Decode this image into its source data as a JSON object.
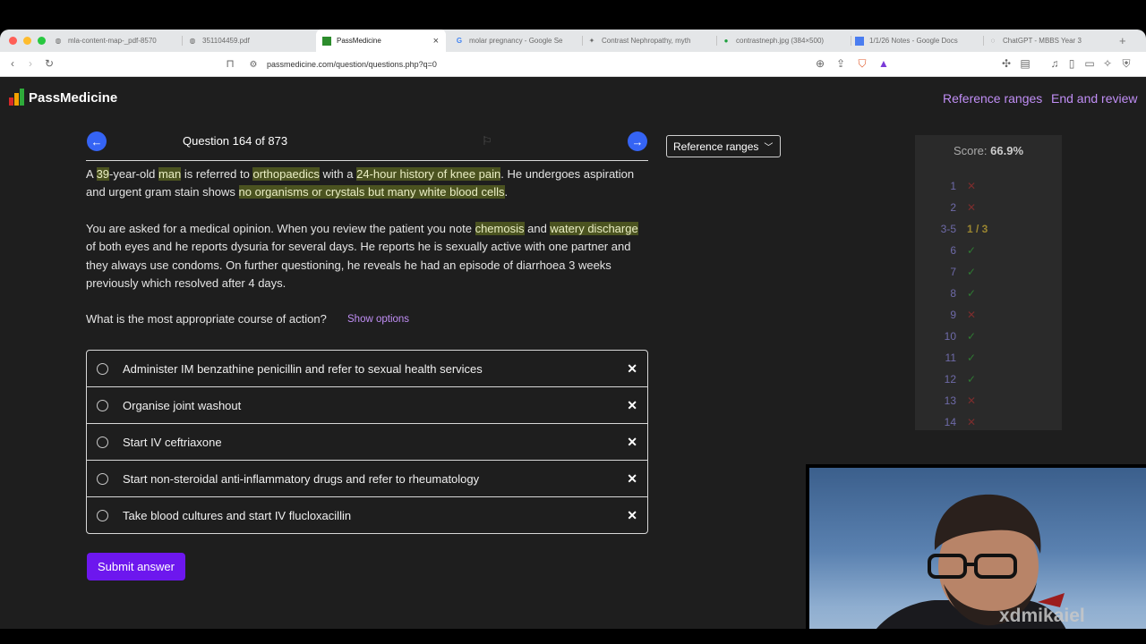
{
  "browser": {
    "tabs": [
      {
        "title": "mla-content-map-_pdf-8570",
        "favicon": "globe-icon",
        "active": false
      },
      {
        "title": "351104459.pdf",
        "favicon": "globe-icon",
        "active": false
      },
      {
        "title": "PassMedicine",
        "favicon": "passmedicine-icon",
        "active": true
      },
      {
        "title": "molar pregnancy - Google Se",
        "favicon": "google-icon",
        "active": false
      },
      {
        "title": "Contrast Nephropathy, myth",
        "favicon": "star-icon",
        "active": false
      },
      {
        "title": "contrastneph.jpg (384×500)",
        "favicon": "image-icon",
        "active": false
      },
      {
        "title": "1/1/26 Notes - Google Docs",
        "favicon": "docs-icon",
        "active": false
      },
      {
        "title": "ChatGPT - MBBS Year 3",
        "favicon": "chatgpt-icon",
        "active": false
      }
    ],
    "url": "passmedicine.com/question/questions.php?q=0"
  },
  "header": {
    "logo_text": "PassMedicine",
    "reference_ranges_link": "Reference ranges",
    "end_review_link": "End and review",
    "link_color": "#c08ef5"
  },
  "question": {
    "counter": "Question 164 of 873",
    "prompt": "What is the most appropriate course of action?",
    "show_options": "Show options",
    "options": [
      "Administer IM benzathine penicillin and refer to sexual health services",
      "Organise joint washout",
      "Start IV ceftriaxone",
      "Start non-steroidal anti-inflammatory drugs and refer to rheumatology",
      "Take blood cultures and start IV flucloxacillin"
    ],
    "submit_label": "Submit answer",
    "reference_dropdown": "Reference ranges"
  },
  "stem": {
    "p1": [
      {
        "t": "A "
      },
      {
        "t": "39",
        "hl": true
      },
      {
        "t": "-year-old "
      },
      {
        "t": "man",
        "hl": true
      },
      {
        "t": " is referred to "
      },
      {
        "t": "orthopaedics",
        "hl": true
      },
      {
        "t": " with a "
      },
      {
        "t": "24-hour history of knee pain",
        "hl": true
      },
      {
        "t": ". He undergoes aspiration and urgent gram stain shows "
      },
      {
        "t": "no organisms or crystals but many white blood cells",
        "hl": true
      },
      {
        "t": "."
      }
    ],
    "p2": [
      {
        "t": "You are asked for a medical opinion. When you review the patient you note "
      },
      {
        "t": "chemosis",
        "hl": true
      },
      {
        "t": " and "
      },
      {
        "t": "watery discharge",
        "hl": true
      },
      {
        "t": " of both eyes and he reports dysuria for several days. He reports he is sexually active with one partner and they always use condoms. On further questioning, he reveals he had an episode of diarrhoea 3 weeks previously which resolved after 4 days."
      }
    ]
  },
  "score_panel": {
    "score_label": "Score:",
    "score_value": "66.9%",
    "rows": [
      {
        "num": "1",
        "mark": "cross"
      },
      {
        "num": "2",
        "mark": "cross"
      },
      {
        "num": "3-5",
        "mark": "partial",
        "text": "1 / 3"
      },
      {
        "num": "6",
        "mark": "tick"
      },
      {
        "num": "7",
        "mark": "tick"
      },
      {
        "num": "8",
        "mark": "tick"
      },
      {
        "num": "9",
        "mark": "cross"
      },
      {
        "num": "10",
        "mark": "tick"
      },
      {
        "num": "11",
        "mark": "tick"
      },
      {
        "num": "12",
        "mark": "tick"
      },
      {
        "num": "13",
        "mark": "cross"
      },
      {
        "num": "14",
        "mark": "cross"
      }
    ]
  },
  "webcam": {
    "watermark": "xdmikaiel"
  },
  "colors": {
    "accent_blue": "#3564f4",
    "submit_purple": "#6d17ee",
    "highlight": "#4b5320"
  }
}
